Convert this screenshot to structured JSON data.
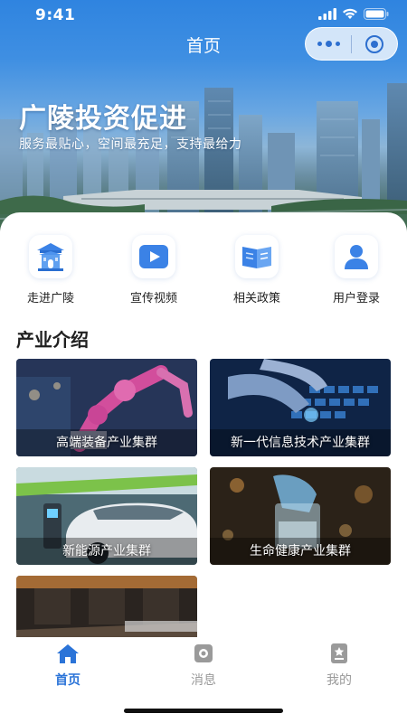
{
  "status_bar": {
    "time": "9:41"
  },
  "nav": {
    "title": "首页"
  },
  "hero": {
    "title": "广陵投资促进",
    "subtitle": "服务最贴心，空间最充足，支持最给力"
  },
  "quick_nav": [
    {
      "label": "走进广陵",
      "icon": "pavilion-icon"
    },
    {
      "label": "宣传视频",
      "icon": "video-play-icon"
    },
    {
      "label": "相关政策",
      "icon": "policy-book-icon"
    },
    {
      "label": "用户登录",
      "icon": "user-icon"
    }
  ],
  "section": {
    "title": "产业介绍"
  },
  "industries": [
    {
      "label": "高端装备产业集群"
    },
    {
      "label": "新一代信息技术产业集群"
    },
    {
      "label": "新能源产业集群"
    },
    {
      "label": "生命健康产业集群"
    },
    {
      "label": ""
    }
  ],
  "tab_bar": {
    "items": [
      {
        "label": "首页",
        "icon": "home-icon",
        "active": true
      },
      {
        "label": "消息",
        "icon": "message-icon",
        "active": false
      },
      {
        "label": "我的",
        "icon": "profile-icon",
        "active": false
      }
    ]
  },
  "colors": {
    "accent": "#2b74d8",
    "tab_inactive": "#9a9a9a",
    "hero_sky": "#2f84e0"
  }
}
